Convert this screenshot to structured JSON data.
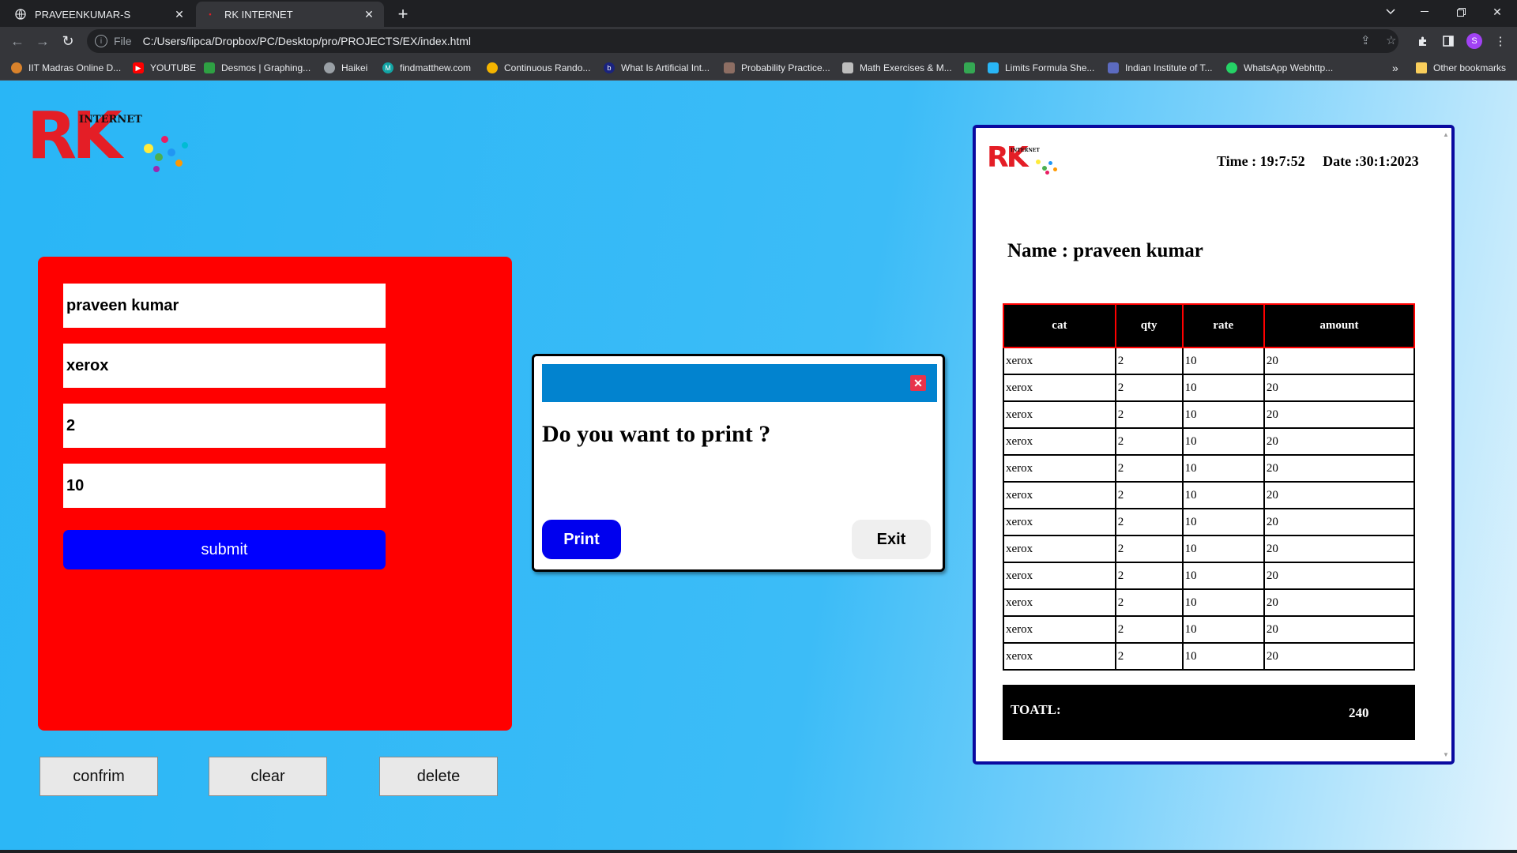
{
  "browser": {
    "tabs": [
      {
        "label": "PRAVEENKUMAR-S"
      },
      {
        "label": "RK INTERNET"
      }
    ],
    "url_scheme": "File",
    "url": "C:/Users/lipca/Dropbox/PC/Desktop/pro/PROJECTS/EX/index.html",
    "profile_initial": "S",
    "bookmarks": [
      {
        "label": "IIT Madras Online D...",
        "icon_color": "#d9822b"
      },
      {
        "label": "YOUTUBE",
        "icon_color": "#ff0000"
      },
      {
        "label": "Desmos | Graphing...",
        "icon_color": "#2ea043"
      },
      {
        "label": "Haikei",
        "icon_color": "#9aa0a6"
      },
      {
        "label": "findmatthew.com",
        "icon_color": "#12a4a4"
      },
      {
        "label": "Continuous Rando...",
        "icon_color": "#f4b400"
      },
      {
        "label": "What Is Artificial Int...",
        "icon_color": "#1a237e"
      },
      {
        "label": "Probability Practice...",
        "icon_color": "#8d6e63"
      },
      {
        "label": "Math Exercises & M...",
        "icon_color": "#bdbdbd"
      },
      {
        "label": "",
        "icon_color": "#34a853"
      },
      {
        "label": "Limits Formula She...",
        "icon_color": "#29b6f6"
      },
      {
        "label": "Indian Institute of T...",
        "icon_color": "#5c6bc0"
      },
      {
        "label": "WhatsApp Webhttp...",
        "icon_color": "#25d366"
      }
    ],
    "overflow_label": "»",
    "other_bookmarks": "Other bookmarks"
  },
  "logo": {
    "letters": "RK",
    "word": "INTERNET"
  },
  "form": {
    "name_value": "praveen kumar",
    "category_value": "xerox",
    "qty_value": "2",
    "rate_value": "10",
    "submit_label": "submit"
  },
  "actions": {
    "confirm_label": "confrim",
    "clear_label": "clear",
    "delete_label": "delete"
  },
  "dialog": {
    "question": "Do you want to print ?",
    "print_label": "Print",
    "exit_label": "Exit",
    "close_glyph": "✕"
  },
  "receipt": {
    "time_date": "Time : 19:7:52     Date :30:1:2023",
    "name_line": "Name : praveen kumar",
    "columns": [
      "cat",
      "qty",
      "rate",
      "amount"
    ],
    "rows": [
      [
        "xerox",
        "2",
        "10",
        "20"
      ],
      [
        "xerox",
        "2",
        "10",
        "20"
      ],
      [
        "xerox",
        "2",
        "10",
        "20"
      ],
      [
        "xerox",
        "2",
        "10",
        "20"
      ],
      [
        "xerox",
        "2",
        "10",
        "20"
      ],
      [
        "xerox",
        "2",
        "10",
        "20"
      ],
      [
        "xerox",
        "2",
        "10",
        "20"
      ],
      [
        "xerox",
        "2",
        "10",
        "20"
      ],
      [
        "xerox",
        "2",
        "10",
        "20"
      ],
      [
        "xerox",
        "2",
        "10",
        "20"
      ],
      [
        "xerox",
        "2",
        "10",
        "20"
      ],
      [
        "xerox",
        "2",
        "10",
        "20"
      ]
    ],
    "total_label": "TOATL:",
    "total_value": "240"
  }
}
